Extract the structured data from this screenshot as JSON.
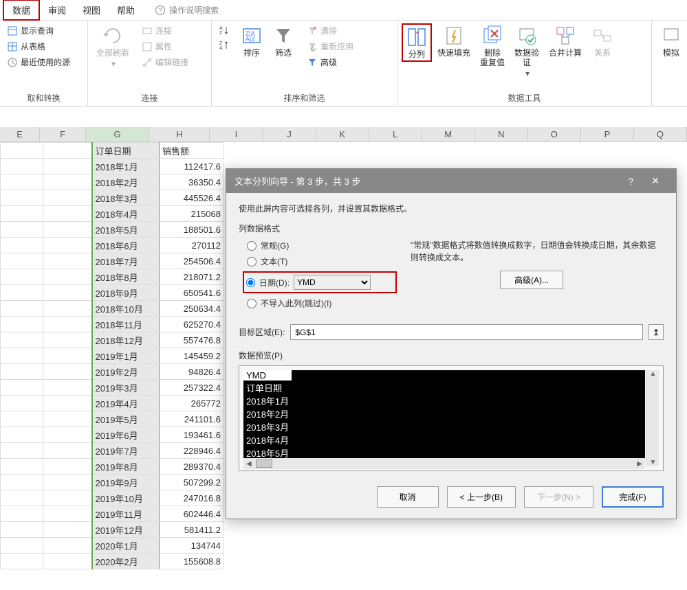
{
  "tabs": {
    "data": "数据",
    "review": "审阅",
    "view": "视图",
    "help": "帮助",
    "search_hint": "操作说明搜索"
  },
  "ribbon": {
    "get_transform": {
      "show_queries": "显示查询",
      "from_table": "从表格",
      "recent": "最近使用的源",
      "label": "取和转换"
    },
    "connections": {
      "refresh_all": "全部刷新",
      "connections": "连接",
      "properties": "属性",
      "edit_links": "编辑链接",
      "label": "连接"
    },
    "sort_filter": {
      "sort": "排序",
      "filter": "筛选",
      "clear": "清除",
      "reapply": "重新应用",
      "advanced": "高级",
      "label": "排序和筛选"
    },
    "data_tools": {
      "text_to_columns": "分列",
      "flash_fill": "快速填充",
      "remove_dup": "删除\n重复值",
      "data_valid": "数据验\n证",
      "consolidate": "合并计算",
      "relationships": "关系",
      "label": "数据工具"
    },
    "simulate": "模拟"
  },
  "columns": [
    "E",
    "F",
    "G",
    "H",
    "I",
    "J",
    "K",
    "L",
    "M",
    "N",
    "O",
    "P",
    "Q"
  ],
  "sheet": {
    "header_g": "订单日期",
    "header_h": "销售额",
    "rows": [
      {
        "g": "2018年1月",
        "h": "112417.6"
      },
      {
        "g": "2018年2月",
        "h": "36350.4"
      },
      {
        "g": "2018年3月",
        "h": "445526.4"
      },
      {
        "g": "2018年4月",
        "h": "215068"
      },
      {
        "g": "2018年5月",
        "h": "188501.6"
      },
      {
        "g": "2018年6月",
        "h": "270112"
      },
      {
        "g": "2018年7月",
        "h": "254506.4"
      },
      {
        "g": "2018年8月",
        "h": "218071.2"
      },
      {
        "g": "2018年9月",
        "h": "650541.6"
      },
      {
        "g": "2018年10月",
        "h": "250634.4"
      },
      {
        "g": "2018年11月",
        "h": "625270.4"
      },
      {
        "g": "2018年12月",
        "h": "557476.8"
      },
      {
        "g": "2019年1月",
        "h": "145459.2"
      },
      {
        "g": "2019年2月",
        "h": "94826.4"
      },
      {
        "g": "2019年3月",
        "h": "257322.4"
      },
      {
        "g": "2019年4月",
        "h": "265772"
      },
      {
        "g": "2019年5月",
        "h": "241101.6"
      },
      {
        "g": "2019年6月",
        "h": "193461.6"
      },
      {
        "g": "2019年7月",
        "h": "228946.4"
      },
      {
        "g": "2019年8月",
        "h": "289370.4"
      },
      {
        "g": "2019年9月",
        "h": "507299.2"
      },
      {
        "g": "2019年10月",
        "h": "247016.8"
      },
      {
        "g": "2019年11月",
        "h": "602446.4"
      },
      {
        "g": "2019年12月",
        "h": "581411.2"
      },
      {
        "g": "2020年1月",
        "h": "134744"
      },
      {
        "g": "2020年2月",
        "h": "155608.8"
      }
    ]
  },
  "dialog": {
    "title": "文本分列向导 - 第 3 步，共 3 步",
    "instr": "使用此屏内容可选择各列，并设置其数据格式。",
    "section_label": "列数据格式",
    "radio_general": "常规(G)",
    "radio_text": "文本(T)",
    "radio_date": "日期(D):",
    "date_format": "YMD",
    "radio_skip": "不导入此列(跳过)(I)",
    "desc": "\"常规\"数据格式将数值转换成数字，日期值会转换成日期，其余数据则转换成文本。",
    "advanced": "高级(A)...",
    "dest_label": "目标区域(E):",
    "dest_value": "$G$1",
    "preview_label": "数据预览(P)",
    "preview_header": "YMD",
    "preview_rows": [
      "订单日期",
      "2018年1月",
      "2018年2月",
      "2018年3月",
      "2018年4月",
      "2018年5月"
    ],
    "btn_cancel": "取消",
    "btn_back": "< 上一步(B)",
    "btn_next": "下一步(N) >",
    "btn_finish": "完成(F)"
  }
}
